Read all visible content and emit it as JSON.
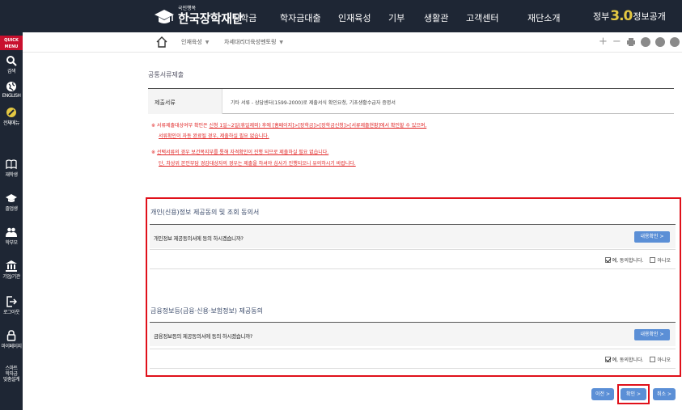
{
  "header": {
    "logo_sub": "국민행복",
    "logo_name": "한국장학재단",
    "nav": [
      "장학금",
      "학자금대출",
      "인재육성",
      "기부",
      "생활관",
      "고객센터",
      "재단소개"
    ],
    "disclosure_prefix": "정부",
    "disclosure_num": "3.0",
    "disclosure_suffix": "정보공개"
  },
  "quick_menu": {
    "title_line1": "QUICK",
    "title_line2": "MENU",
    "items": [
      {
        "label": "검색",
        "icon": "search-icon"
      },
      {
        "label": "ENGLISH",
        "icon": "globe-icon"
      },
      {
        "label": "전체메뉴",
        "icon": "compass-icon"
      },
      {
        "label": "재학생",
        "icon": "book-icon"
      },
      {
        "label": "졸업생",
        "icon": "graduation-cap-icon"
      },
      {
        "label": "학부모",
        "icon": "parents-icon"
      },
      {
        "label": "기업/기관",
        "icon": "institution-icon"
      },
      {
        "label": "로그아웃",
        "icon": "logout-icon"
      },
      {
        "label": "마이페이지",
        "icon": "lock-icon"
      }
    ],
    "smart_lines": [
      "스마트",
      "학자금",
      "맞춤설계"
    ]
  },
  "breadcrumb": {
    "level1": "인재육성",
    "level2": "차세대리더육성멘토링"
  },
  "tools": {
    "plus": "+",
    "minus": "−"
  },
  "docs": {
    "title": "공통서류제출",
    "row_label": "제출서류",
    "row_value": "기타 서류 - 상담센터(1599-2000)로 제출서식 확인요청, 기초생활수급자 증명서",
    "note1_pre": "※ 서류제출대상여부 확인은 ",
    "note1_link": "신청 1일~2일(휴일제외) 후에 [홈페이지]>[장학금]>[장학금신청]>[서류제출현황]에서 확인할 수 있으며,",
    "note1_line2": "서류확인이 자동 완료될 경우, 제출하실 필요 없습니다.",
    "note2_pre": "※ ",
    "note2_link": "선택서류의 경우 보건복지부를 통해 자격확인이 진행 되므로 제출하실 필요 없습니다.",
    "note2_line2": "단, 차상위 본인부담 경감대상자의 경우는 제출을 하셔야 심사가 진행되오니 유의하시기 바랍니다."
  },
  "consent": {
    "section1_title": "개인(신용)정보 제공동의 및 조회 동의서",
    "q1": "개인정보 제공동의서에 동의 하시겠습니까?",
    "section2_title": "금융정보등(금융·신용·보험정보) 제공동의",
    "q2": "금융정보등의 제공동의서에 동의 하시겠습니까?",
    "view_button": "내용확인 >",
    "agree_label": "예, 동의합니다.",
    "disagree_label": "아니오",
    "agree1_checked": true,
    "agree2_checked": true
  },
  "actions": {
    "prev": "이전 >",
    "confirm": "확인 >",
    "cancel": "취소 >"
  },
  "colors": {
    "header_bg": "#1e2634",
    "accent_red": "#e0101a",
    "button_blue": "#5b8fd6"
  }
}
